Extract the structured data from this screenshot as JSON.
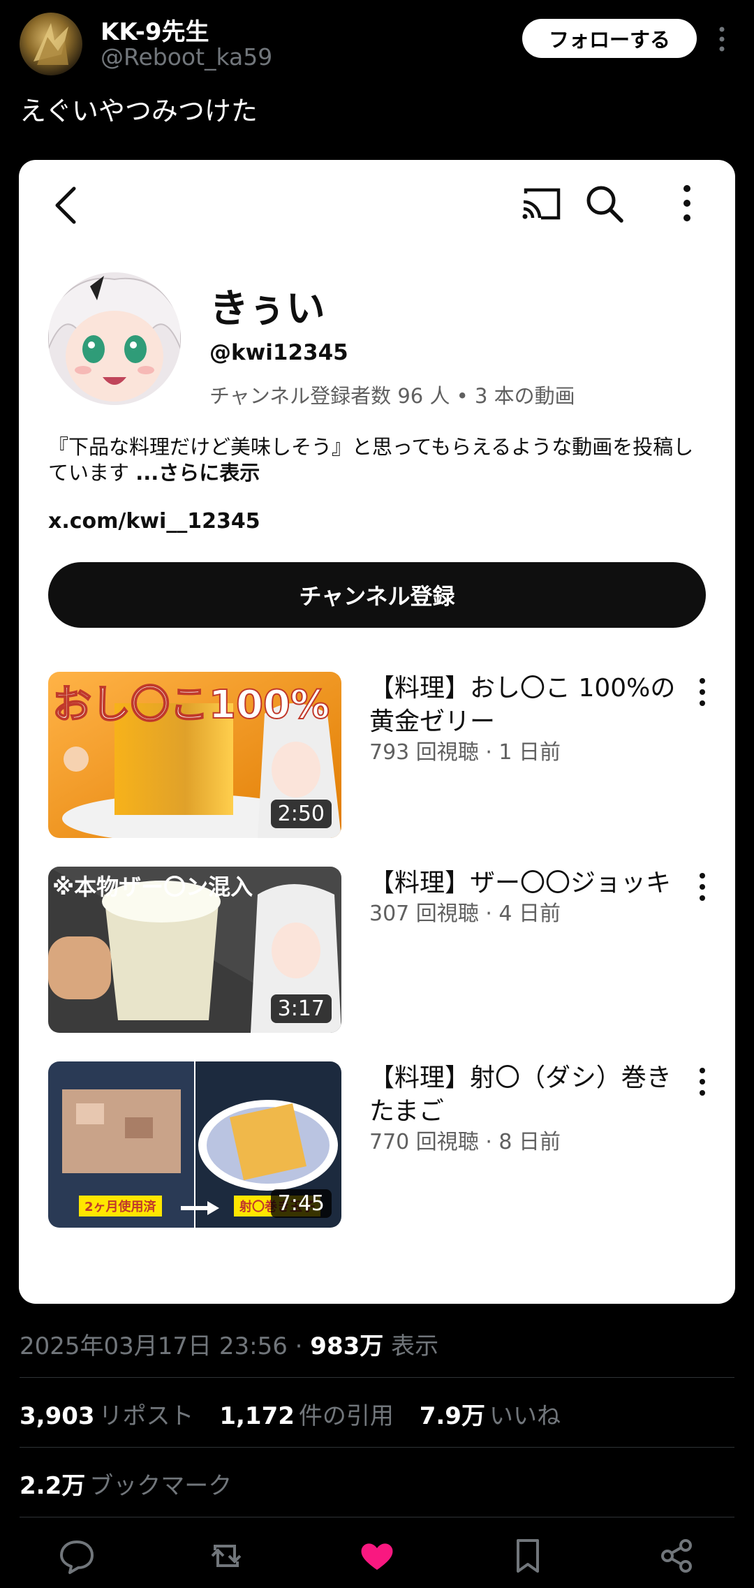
{
  "tweet": {
    "display_name": "KK-9先生",
    "handle": "@Reboot_ka59",
    "follow_label": "フォローする",
    "text": "えぐいやつみつけた",
    "timestamp": "2025年03月17日 23:56",
    "views": "983万",
    "views_label": "表示",
    "reposts": "3,903",
    "reposts_label": "リポスト",
    "quotes": "1,172",
    "quotes_label": "件の引用",
    "likes": "7.9万",
    "likes_label": "いいね",
    "bookmarks": "2.2万",
    "bookmarks_label": "ブックマーク"
  },
  "channel": {
    "name": "きぅい",
    "handle": "@kwi12345",
    "stats": "チャンネル登録者数 96 人 • 3 本の動画",
    "description": "『下品な料理だけど美味しそう』と思ってもらえるような動画を投稿しています",
    "more_label": "...さらに表示",
    "link": "x.com/kwi__12345",
    "subscribe_label": "チャンネル登録"
  },
  "videos": [
    {
      "title": "【料理】おし〇こ 100%の黄金ゼリー",
      "meta": "793 回視聴 · 1 日前",
      "duration": "2:50",
      "thumb_text": "おし〇こ100%"
    },
    {
      "title": "【料理】ザー〇〇ジョッキ",
      "meta": "307 回視聴 · 4 日前",
      "duration": "3:17",
      "thumb_text": "※本物ザー〇ン混入"
    },
    {
      "title": "【料理】射〇（ダシ）巻きたまご",
      "meta": "770 回視聴 · 8 日前",
      "duration": "7:45",
      "thumb_left_label": "2ヶ月使用済",
      "thumb_right_label": "射〇巻き玉子"
    }
  ],
  "colors": {
    "like_pink": "#f91880",
    "muted": "#71767b",
    "card_bg": "#ffffff"
  }
}
